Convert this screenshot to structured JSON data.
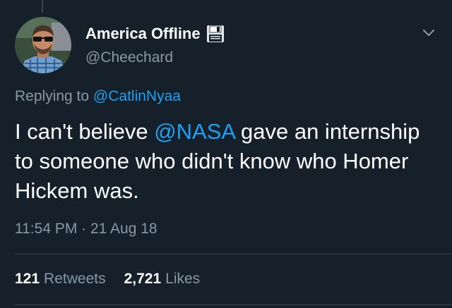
{
  "tweet": {
    "display_name": "America Offline",
    "name_emoji": "floppy-disk-icon",
    "handle": "@Cheechard",
    "replying_prefix": "Replying to",
    "replying_to": "@CatlinNyaa",
    "text_before": "I can't believe ",
    "text_mention": "@NASA",
    "text_after": " gave an internship to someone who didn't know who Homer Hickem was.",
    "timestamp": "11:54 PM · 21 Aug 18",
    "retweets_count": "121",
    "retweets_label": "Retweets",
    "likes_count": "2,721",
    "likes_label": "Likes"
  },
  "colors": {
    "background": "#15202b",
    "text": "#ffffff",
    "secondary_text": "#8899a6",
    "link": "#1da1f2",
    "divider": "#38444d"
  }
}
